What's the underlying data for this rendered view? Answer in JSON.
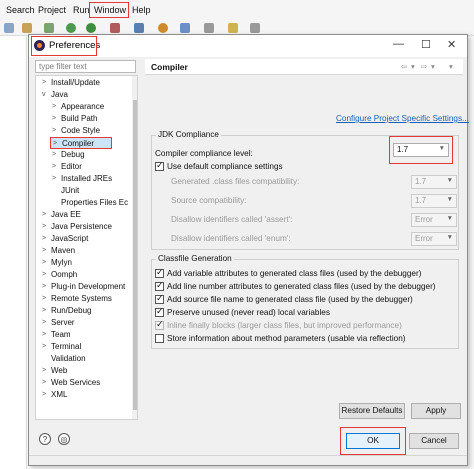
{
  "ide": {
    "menu": [
      "Search",
      "Project",
      "Run",
      "Window",
      "Help"
    ]
  },
  "dialog": {
    "title": "Preferences",
    "window_controls": [
      "—",
      "☐",
      "✕"
    ],
    "filter_placeholder": "type filter text",
    "tree": [
      {
        "label": "Install/Update",
        "twisty": ">"
      },
      {
        "label": "Java",
        "twisty": "v"
      },
      {
        "label": "Appearance",
        "twisty": ">"
      },
      {
        "label": "Build Path",
        "twisty": ">"
      },
      {
        "label": "Code Style",
        "twisty": ">"
      },
      {
        "label": "Compiler",
        "twisty": ">",
        "selected": true
      },
      {
        "label": "Debug",
        "twisty": ">"
      },
      {
        "label": "Editor",
        "twisty": ">"
      },
      {
        "label": "Installed JREs",
        "twisty": ">"
      },
      {
        "label": "JUnit",
        "twisty": ""
      },
      {
        "label": "Properties Files Ec",
        "twisty": ""
      },
      {
        "label": "Java EE",
        "twisty": ">"
      },
      {
        "label": "Java Persistence",
        "twisty": ">"
      },
      {
        "label": "JavaScript",
        "twisty": ">"
      },
      {
        "label": "Maven",
        "twisty": ">"
      },
      {
        "label": "Mylyn",
        "twisty": ">"
      },
      {
        "label": "Oomph",
        "twisty": ">"
      },
      {
        "label": "Plug-in Development",
        "twisty": ">"
      },
      {
        "label": "Remote Systems",
        "twisty": ">"
      },
      {
        "label": "Run/Debug",
        "twisty": ">"
      },
      {
        "label": "Server",
        "twisty": ">"
      },
      {
        "label": "Team",
        "twisty": ">"
      },
      {
        "label": "Terminal",
        "twisty": ">"
      },
      {
        "label": "Validation",
        "twisty": ""
      },
      {
        "label": "Web",
        "twisty": ">"
      },
      {
        "label": "Web Services",
        "twisty": ">"
      },
      {
        "label": "XML",
        "twisty": ">"
      }
    ],
    "page": {
      "title": "Compiler",
      "nav_arrows": [
        "⇦",
        "▾",
        "⇨",
        "▾",
        "▾"
      ],
      "project_link": "Configure Project Specific Settings...",
      "jdk": {
        "group_label": "JDK Compliance",
        "compliance_label": "Compiler compliance level:",
        "compliance_value": "1.7",
        "use_default_label": "Use default compliance settings",
        "use_default_checked": true,
        "generated_label": "Generated .class files compatibility:",
        "generated_value": "1.7",
        "source_label": "Source compatibility:",
        "source_value": "1.7",
        "assert_label": "Disallow identifiers called 'assert':",
        "assert_value": "Error",
        "enum_label": "Disallow identifiers called 'enum':",
        "enum_value": "Error"
      },
      "classfile": {
        "group_label": "Classfile Generation",
        "options": [
          {
            "label": "Add variable attributes to generated class files (used by the debugger)",
            "checked": true,
            "disabled": false
          },
          {
            "label": "Add line number attributes to generated class files (used by the debugger)",
            "checked": true,
            "disabled": false
          },
          {
            "label": "Add source file name to generated class file (used by the debugger)",
            "checked": true,
            "disabled": false
          },
          {
            "label": "Preserve unused (never read) local variables",
            "checked": true,
            "disabled": false
          },
          {
            "label": "Inline finally blocks (larger class files, but improved performance)",
            "checked": true,
            "disabled": true
          },
          {
            "label": "Store information about method parameters (usable via reflection)",
            "checked": false,
            "disabled": false
          }
        ]
      },
      "restore_defaults": "Restore Defaults",
      "apply": "Apply"
    },
    "ok": "OK",
    "cancel": "Cancel",
    "help_icons": [
      "?",
      "◎"
    ]
  },
  "colors": {
    "annotation_red": "#e53935",
    "selection_blue": "#cce4f7",
    "link_blue": "#1a5fb4"
  }
}
